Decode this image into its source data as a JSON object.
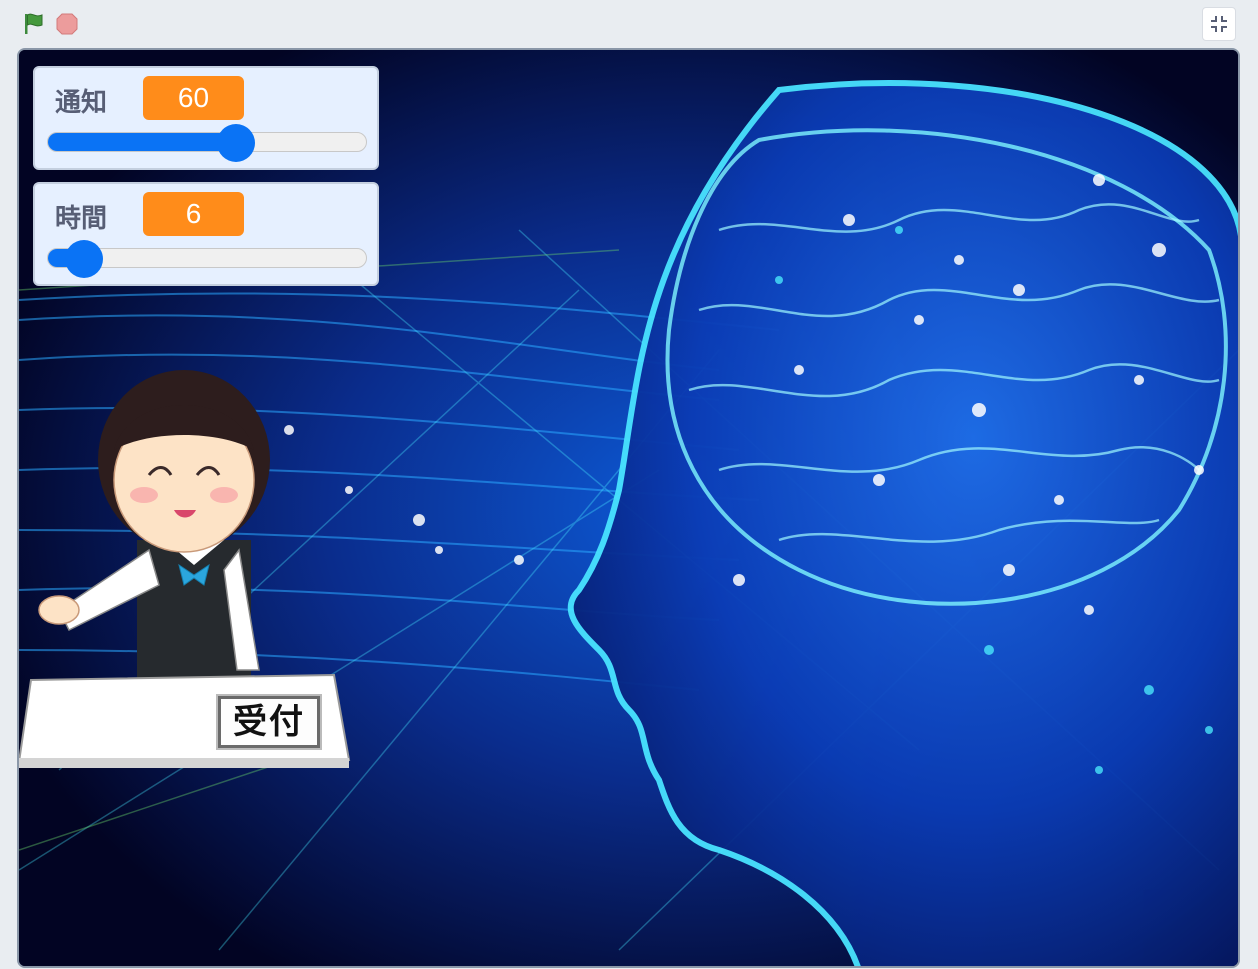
{
  "toolbar": {
    "green_flag": "green-flag-icon",
    "stop": "stop-icon",
    "fullscreen": "exit-fullscreen-icon"
  },
  "monitors": [
    {
      "label": "通知",
      "value": "60",
      "slider_fraction": 0.6
    },
    {
      "label": "時間",
      "value": "6",
      "slider_fraction": 0.06
    }
  ],
  "sprite": {
    "desk_sign": "受付"
  },
  "colors": {
    "value_badge": "#ff8c1a",
    "slider_accent": "#0a73f5",
    "monitor_bg": "#e6f0ff"
  }
}
